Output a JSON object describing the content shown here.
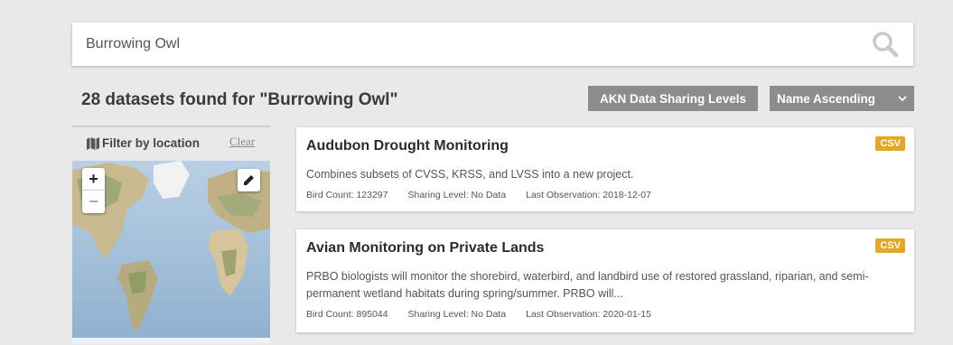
{
  "search": {
    "value": "Burrowing Owl",
    "placeholder": ""
  },
  "results": {
    "title": "28 datasets found for \"Burrowing Owl\""
  },
  "toolbar": {
    "levels_label": "AKN Data Sharing Levels",
    "sort_value": "Name Ascending"
  },
  "filter": {
    "label": "Filter by location",
    "clear_label": "Clear"
  },
  "map": {
    "zoom_in": "+",
    "zoom_out": "−"
  },
  "datasets": [
    {
      "title": "Audubon Drought Monitoring",
      "format": "CSV",
      "description": "Combines subsets of CVSS, KRSS, and LVSS into a new project.",
      "bird_count": "Bird Count: 123297",
      "sharing_level": "Sharing Level: No Data",
      "last_observation": "Last Observation: 2018-12-07"
    },
    {
      "title": "Avian Monitoring on Private Lands",
      "format": "CSV",
      "description": "PRBO biologists will monitor the shorebird, waterbird, and landbird use of restored grassland, riparian, and semi-permanent wetland habitats during spring/summer. PRBO will...",
      "bird_count": "Bird Count: 895044",
      "sharing_level": "Sharing Level: No Data",
      "last_observation": "Last Observation: 2020-01-15"
    }
  ],
  "colors": {
    "badge": "#e4a824",
    "button": "#8c8c8c",
    "background": "#e9e9e9"
  }
}
